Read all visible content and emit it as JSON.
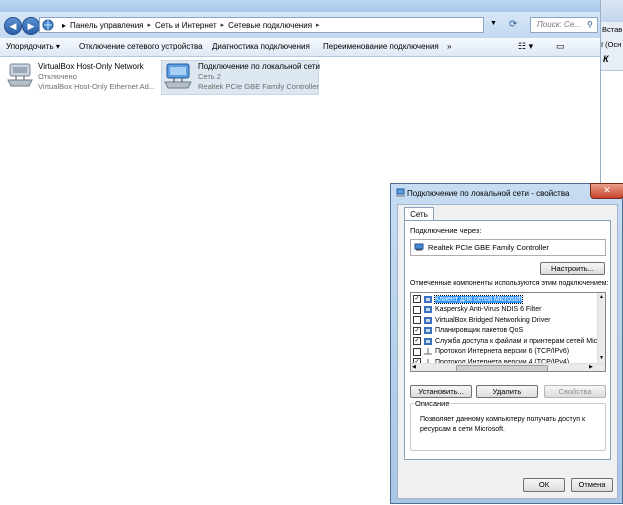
{
  "explorer": {
    "breadcrumb": [
      "Панель управления",
      "Сеть и Интернет",
      "Сетевые подключения"
    ],
    "search_placeholder": "Поиск: Се...",
    "toolbar": {
      "organize": "Упорядочить",
      "disable": "Отключение сетевого устройства",
      "diagnose": "Диагностика подключения",
      "rename": "Переименование подключения",
      "more": "»"
    },
    "connections": [
      {
        "name": "VirtualBox Host-Only Network",
        "status": "Отключено",
        "adapter": "VirtualBox Host-Only Ethernet Ad..."
      },
      {
        "name": "Подключение по локальной сети",
        "status": "Сеть  2",
        "adapter": "Realtek PCIe GBE Family Controller"
      }
    ]
  },
  "side_window": {
    "tab": "Встав",
    "line": "I (Осн"
  },
  "dialog": {
    "title": "Подключение по локальной сети - свойства",
    "tab": "Сеть",
    "connect_via_label": "Подключение через:",
    "adapter": "Realtek PCIe GBE Family Controller",
    "configure_button": "Настроить...",
    "components_label": "Отмеченные компоненты используются этим подключением:",
    "components": [
      {
        "label": "Клиент для сетей Microsoft",
        "checked": true,
        "selected": true
      },
      {
        "label": "Kaspersky Anti-Virus NDIS 6 Filter",
        "checked": false,
        "selected": false
      },
      {
        "label": "VirtualBox Bridged Networking Driver",
        "checked": false,
        "selected": false
      },
      {
        "label": "Планировщик пакетов QoS",
        "checked": true,
        "selected": false
      },
      {
        "label": "Служба доступа к файлам и принтерам сетей Micro",
        "checked": true,
        "selected": false
      },
      {
        "label": "Протокол Интернета версии 6 (TCP/IPv6)",
        "checked": false,
        "selected": false
      },
      {
        "label": "Протокол Интернета версии 4 (TCP/IPv4)",
        "checked": true,
        "selected": false
      }
    ],
    "install_button": "Установить...",
    "remove_button": "Удалить",
    "properties_button": "Свойства",
    "description_label": "Описание",
    "description_text": "Позволяет данному компьютеру получать доступ к ресурсам в сети Microsoft.",
    "ok_button": "ОК",
    "cancel_button": "Отмена"
  },
  "colors": {
    "selection": "#3399ff",
    "title_gradient": "#a8c6e6"
  }
}
